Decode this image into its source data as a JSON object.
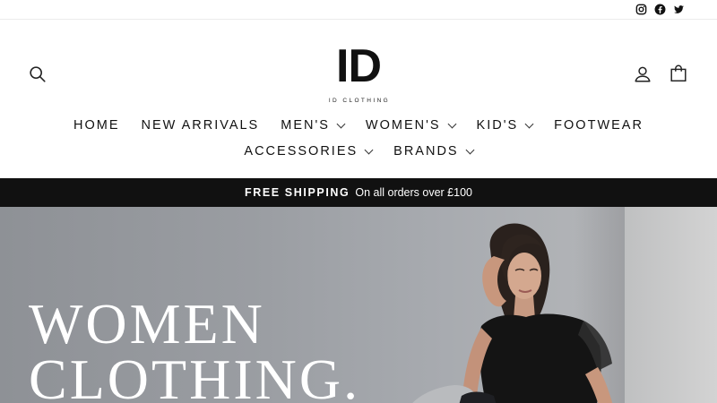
{
  "social": {
    "items": [
      {
        "name": "instagram-icon"
      },
      {
        "name": "facebook-icon"
      },
      {
        "name": "twitter-icon"
      }
    ]
  },
  "header": {
    "logo_mark": "ID",
    "logo_text": "ID CLOTHING",
    "icons": {
      "search": "search-icon",
      "account": "user-icon",
      "cart": "bag-icon"
    }
  },
  "nav": {
    "row1": [
      {
        "label": "HOME",
        "dropdown": false
      },
      {
        "label": "NEW ARRIVALS",
        "dropdown": false
      },
      {
        "label": "MEN'S",
        "dropdown": true
      },
      {
        "label": "WOMEN'S",
        "dropdown": true
      },
      {
        "label": "KID'S",
        "dropdown": true
      },
      {
        "label": "FOOTWEAR",
        "dropdown": false
      }
    ],
    "row2": [
      {
        "label": "ACCESSORIES",
        "dropdown": true
      },
      {
        "label": "BRANDS",
        "dropdown": true
      }
    ]
  },
  "announcement": {
    "bold": "FREE SHIPPING",
    "text": "On all orders over £100"
  },
  "hero": {
    "title_line1": "WOMEN",
    "title_line2": "CLOTHING."
  },
  "colors": {
    "announcement_bg": "#111111",
    "text": "#111111",
    "hero_text": "#ffffff"
  }
}
